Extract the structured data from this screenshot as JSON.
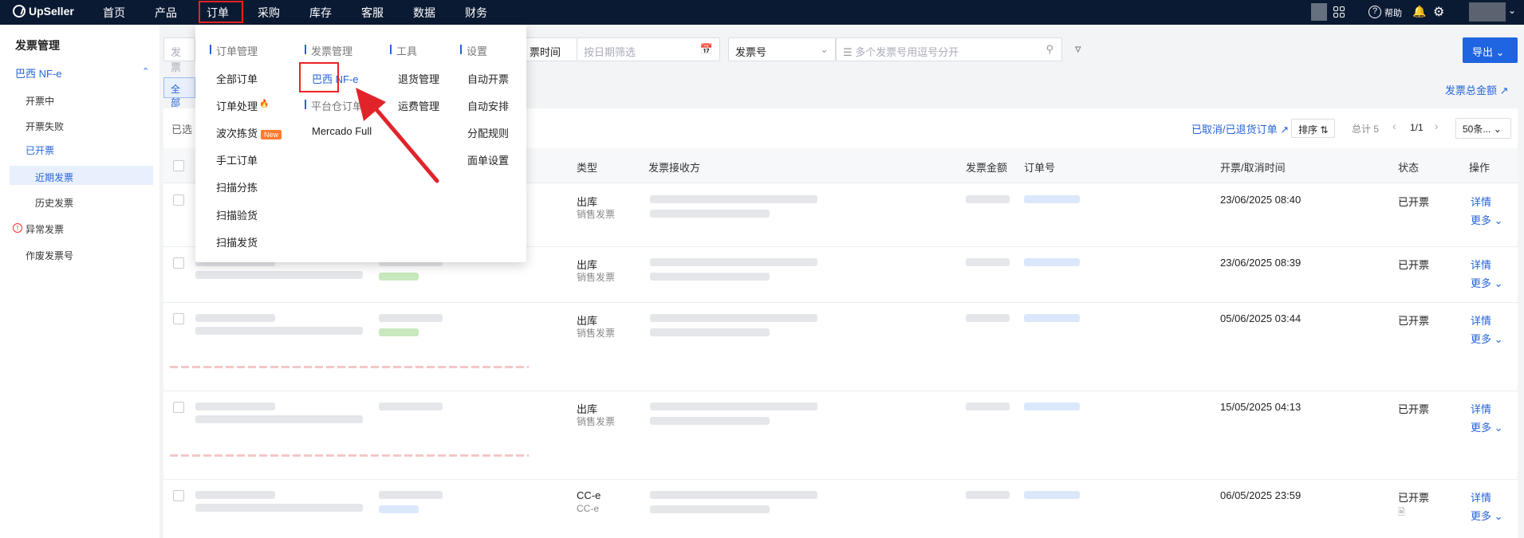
{
  "topbar": {
    "brand": "UpSeller",
    "nav": [
      "首页",
      "产品",
      "订单",
      "采购",
      "库存",
      "客服",
      "数据",
      "财务"
    ],
    "active_nav": "订单",
    "help": "帮助"
  },
  "sidebar": {
    "title": "发票管理",
    "group": "巴西 NF-e",
    "items": [
      "开票中",
      "开票失败",
      "已开票",
      "近期发票",
      "历史发票",
      "异常发票",
      "作废发票号"
    ]
  },
  "filters": {
    "invoice_placeholder": "发票",
    "time_label": "票时间",
    "date_placeholder": "按日期筛选",
    "invoice_no_select": "发票号",
    "search_placeholder": "多个发票号用逗号分开",
    "export": "导出"
  },
  "toolbar": {
    "all_tab": "全部",
    "total_amount_link": "发票总金额",
    "selected_label": "已选",
    "cancelled_link": "已取消/已退货订单",
    "sort": "排序",
    "total": "总计 5",
    "page": "1/1",
    "page_size": "50条..."
  },
  "table": {
    "headers": [
      "类型",
      "发票接收方",
      "发票金额",
      "订单号",
      "开票/取消时间",
      "状态",
      "操作"
    ],
    "rows": [
      {
        "type": "出库",
        "type_sub": "销售发票",
        "time": "23/06/2025 08:40",
        "status": "已开票",
        "detail": "详情",
        "more": "更多"
      },
      {
        "type": "出库",
        "type_sub": "销售发票",
        "time": "23/06/2025 08:39",
        "status": "已开票",
        "detail": "详情",
        "more": "更多"
      },
      {
        "type": "出库",
        "type_sub": "销售发票",
        "time": "05/06/2025 03:44",
        "status": "已开票",
        "detail": "详情",
        "more": "更多"
      },
      {
        "type": "出库",
        "type_sub": "销售发票",
        "time": "15/05/2025 04:13",
        "status": "已开票",
        "detail": "详情",
        "more": "更多"
      },
      {
        "type": "CC-e",
        "type_sub": "CC-e",
        "time": "06/05/2025 23:59",
        "status": "已开票",
        "detail": "详情",
        "more": "更多"
      }
    ]
  },
  "menu": {
    "col1_header": "订单管理",
    "col1": [
      "全部订单",
      "订单处理",
      "波次拣货",
      "手工订单",
      "扫描分拣",
      "扫描验货",
      "扫描发货"
    ],
    "new_badge": "New",
    "col2_header": "发票管理",
    "col2_item": "巴西 NF-e",
    "col2b_header": "平台仓订单",
    "col2b_item": "Mercado Full",
    "col3_header": "工具",
    "col3": [
      "退货管理",
      "运费管理"
    ],
    "col4_header": "设置",
    "col4": [
      "自动开票",
      "自动安排",
      "分配规则",
      "面单设置"
    ]
  },
  "colors": {
    "accent": "#1f64e0",
    "nav_bg": "#0b1a33",
    "highlight": "#e22222"
  }
}
